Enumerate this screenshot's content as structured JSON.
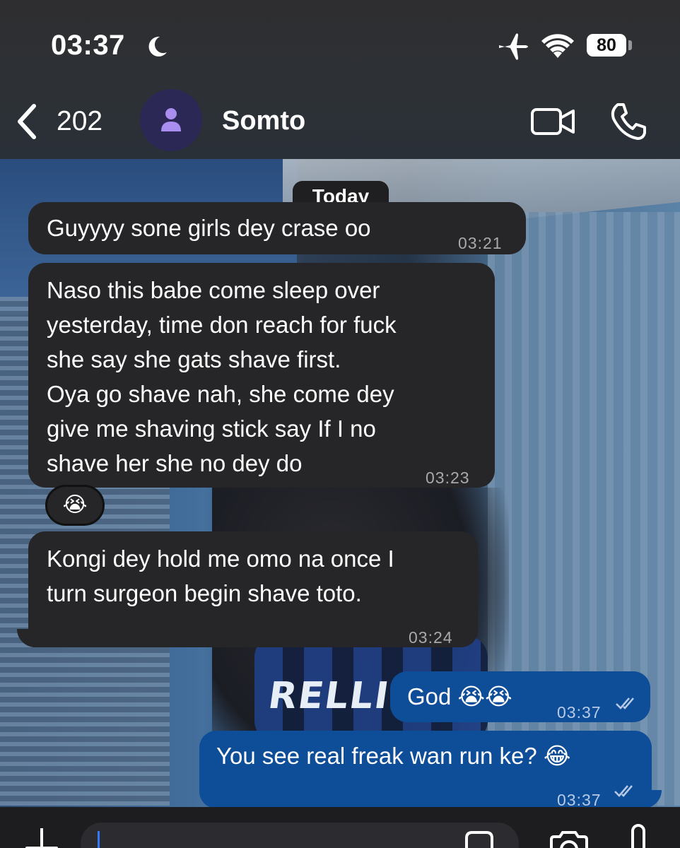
{
  "status_bar": {
    "time": "03:37",
    "battery": "80",
    "icons": [
      "moon-icon",
      "airplane-icon",
      "wifi-icon",
      "battery-icon"
    ]
  },
  "nav": {
    "back_count": "202",
    "contact_name": "Somto",
    "icons": [
      "back-chevron-icon",
      "avatar-person-icon",
      "video-call-icon",
      "phone-icon"
    ]
  },
  "chat": {
    "date_label": "Today",
    "messages": [
      {
        "direction": "in",
        "text": "Guyyyy sone girls dey crase  oo",
        "time": "03:21"
      },
      {
        "direction": "in",
        "text": "Naso this babe come sleep over\nyesterday, time don reach for fuck\nshe say she gats shave first.\nOya go shave nah,  she come dey\ngive me shaving stick say  If I no\nshave her she no dey do",
        "time": "03:23",
        "reaction": "😭"
      },
      {
        "direction": "in",
        "text": "Kongi dey hold me omo na once I\nturn surgeon begin shave toto.",
        "time": "03:24"
      },
      {
        "direction": "out",
        "text": "God 😭😭",
        "time": "03:37",
        "status": "read"
      },
      {
        "direction": "out",
        "text": "You see real freak wan run ke? 😂",
        "time": "03:37",
        "status": "read"
      }
    ]
  },
  "composer": {
    "value": "",
    "icons": [
      "plus-icon",
      "sticker-icon",
      "camera-icon",
      "microphone-icon"
    ]
  },
  "colors": {
    "incoming_bubble": "#262628",
    "outgoing_bubble": "#0e4d98",
    "header": "#2e2e30",
    "avatar_bg": "#2c2855",
    "avatar_icon": "#a98ef0"
  }
}
